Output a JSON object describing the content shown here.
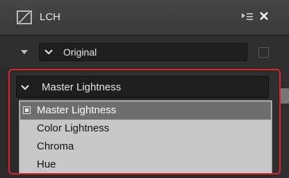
{
  "window": {
    "title": "LCH",
    "title_icon": "lch-curve-icon",
    "menu_icon": "panel-menu-icon",
    "close_icon": "close-icon"
  },
  "preset": {
    "label": "Original",
    "expand_icon": "triangle-down-icon",
    "chevron_icon": "chevron-down-icon",
    "checked": false
  },
  "channel": {
    "selected_label": "Master Lightness",
    "chevron_icon": "chevron-down-icon",
    "options": [
      {
        "label": "Master Lightness",
        "selected": true
      },
      {
        "label": "Color Lightness",
        "selected": false
      },
      {
        "label": "Chroma",
        "selected": false
      },
      {
        "label": "Hue",
        "selected": false
      }
    ]
  },
  "colors": {
    "highlight_frame": "#e0202a",
    "selected_option_bg": "#6e6e6e",
    "list_bg": "#c7c7c7"
  }
}
